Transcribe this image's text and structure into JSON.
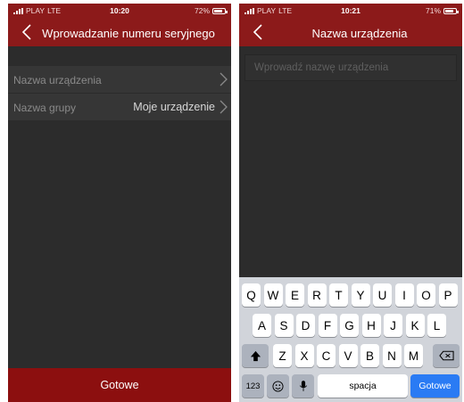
{
  "colors": {
    "accent": "#8c1a1a",
    "button": "#8c0f0f",
    "background": "#2c2c2c",
    "keyboard_return": "#2a7bf4"
  },
  "left": {
    "status": {
      "carrier": "PLAY",
      "network": "LTE",
      "time": "10:20",
      "battery": "72%"
    },
    "header": {
      "back_icon": "chevron-left-icon",
      "title": "Wprowadzanie numeru seryjnego"
    },
    "rows": [
      {
        "label": "Nazwa urządzenia",
        "value": ""
      },
      {
        "label": "Nazwa grupy",
        "value": "Moje urządzenie"
      }
    ],
    "done_label": "Gotowe"
  },
  "right": {
    "status": {
      "carrier": "PLAY",
      "network": "LTE",
      "time": "10:21",
      "battery": "71%"
    },
    "header": {
      "back_icon": "chevron-left-icon",
      "title": "Nazwa urządzenia"
    },
    "input": {
      "value": "",
      "placeholder": "Wprowadź nazwę urządzenia"
    },
    "keyboard": {
      "row1": [
        "Q",
        "W",
        "E",
        "R",
        "T",
        "Y",
        "U",
        "I",
        "O",
        "P"
      ],
      "row2": [
        "A",
        "S",
        "D",
        "F",
        "G",
        "H",
        "J",
        "K",
        "L"
      ],
      "row3": [
        "Z",
        "X",
        "C",
        "V",
        "B",
        "N",
        "M"
      ],
      "shift_icon": "shift-icon",
      "backspace_icon": "backspace-icon",
      "numbers_label": "123",
      "emoji_icon": "emoji-icon",
      "mic_icon": "microphone-icon",
      "space_label": "spacja",
      "return_label": "Gotowe"
    }
  }
}
